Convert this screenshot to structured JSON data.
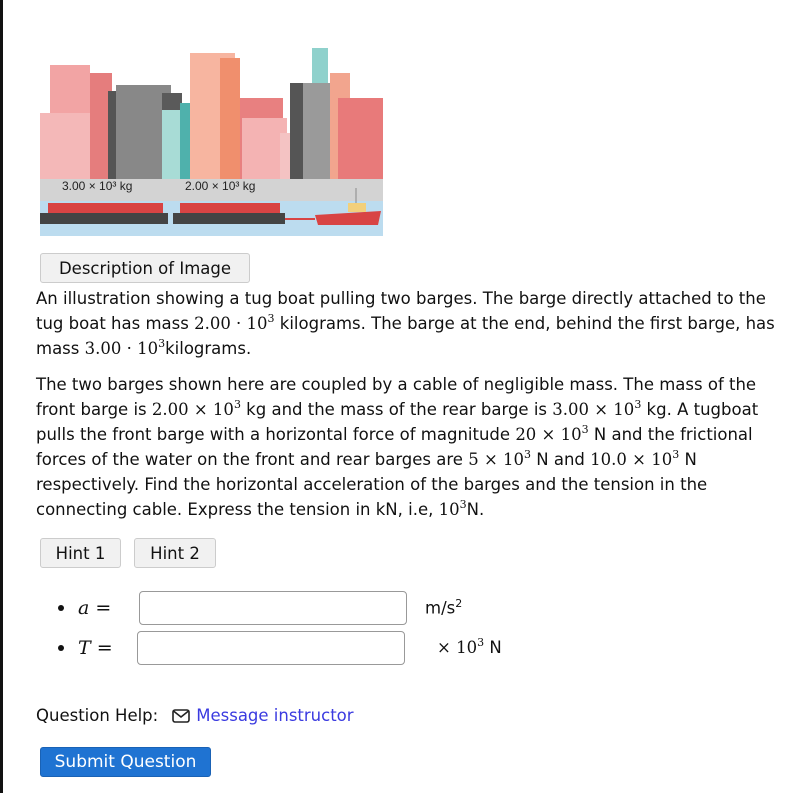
{
  "figure": {
    "rear_barge_label": "3.00 × 10³ kg",
    "front_barge_label": "2.00 × 10³ kg"
  },
  "description_button": "Description of Image",
  "description": [
    {
      "t": "An illustration showing a tug boat pulling two barges. The barge directly attached to the tug boat has mass "
    },
    {
      "base": "2.00 · 10",
      "exp": "3"
    },
    {
      "t": " kilograms. The barge at the end, behind the first barge, has mass "
    },
    {
      "base": "3.00 · 10",
      "exp": "3"
    },
    {
      "t": "kilograms."
    }
  ],
  "question": [
    {
      "t": "The two barges shown here are coupled by a cable of negligible mass. The mass of the front barge is "
    },
    {
      "base": "2.00 × 10",
      "exp": "3"
    },
    {
      "t": " kg and the mass of the rear barge is "
    },
    {
      "base": "3.00 × 10",
      "exp": "3"
    },
    {
      "t": " kg. A tugboat pulls the front barge with a horizontal force of magnitude "
    },
    {
      "base": "20 × 10",
      "exp": "3"
    },
    {
      "t": " N and the frictional forces of the water on the front and rear barges are "
    },
    {
      "base": "5 × 10",
      "exp": "3"
    },
    {
      "t": " N and "
    },
    {
      "base": "10.0 × 10",
      "exp": "3"
    },
    {
      "t": " N respectively. Find the horizontal acceleration of the barges and the tension in the connecting cable. Express the tension in kN, i.e, "
    },
    {
      "base": "10",
      "exp": "3"
    },
    {
      "t": "N."
    }
  ],
  "hints": [
    "Hint 1",
    "Hint 2"
  ],
  "answers": [
    {
      "variable": "a =",
      "value": "",
      "unit": "m/s",
      "unit_exp": "2"
    },
    {
      "variable": "T =",
      "value": "",
      "unit_prefix": "× 10",
      "unit_prefix_exp": "3",
      "unit": " N"
    }
  ],
  "help": {
    "label": "Question Help:",
    "icon": "envelope-icon",
    "link": "Message instructor"
  },
  "submit_label": "Submit Question"
}
